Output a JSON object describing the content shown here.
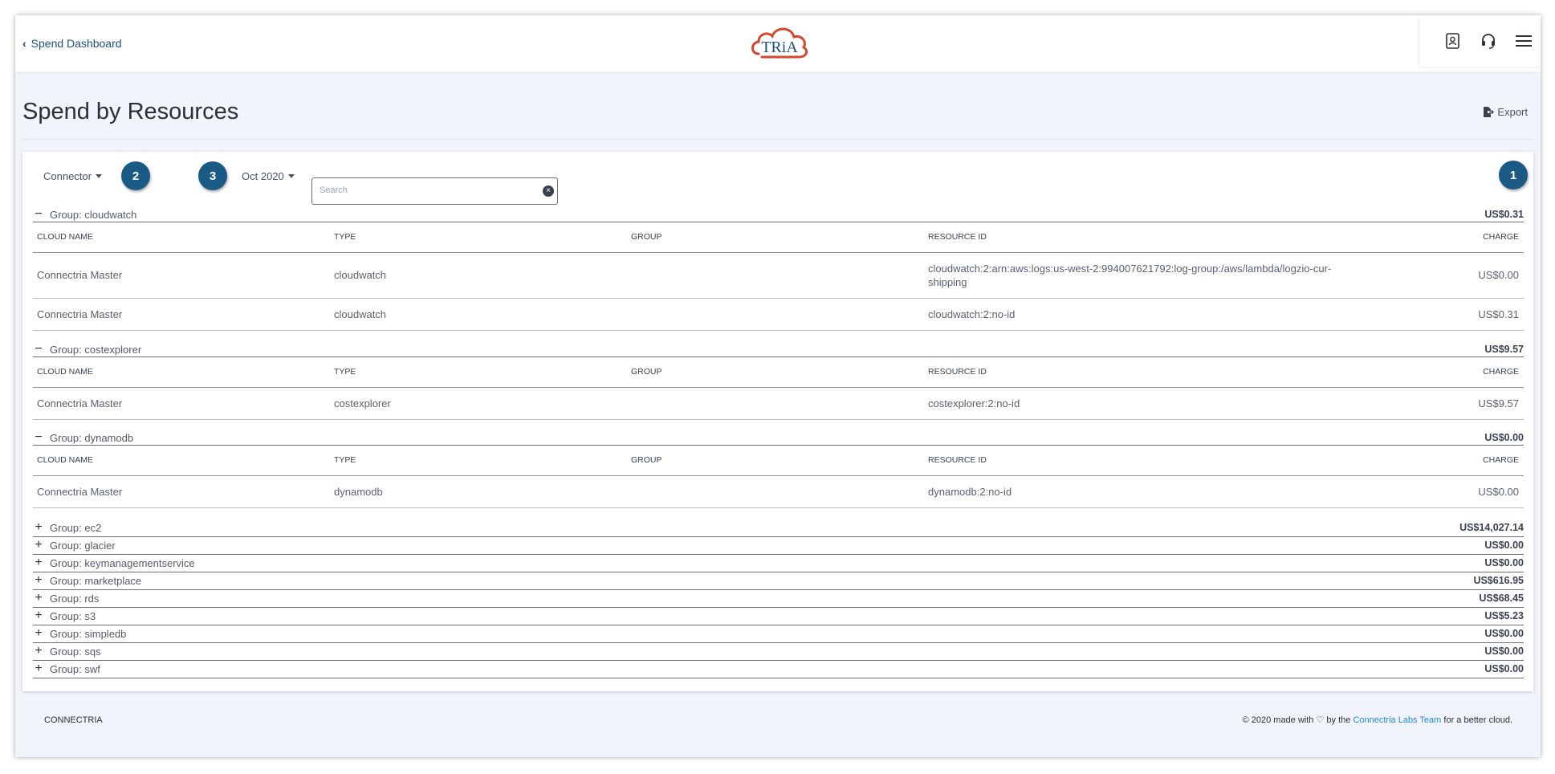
{
  "header": {
    "back_label": "Spend Dashboard",
    "logo_text": "TRiA"
  },
  "page": {
    "title": "Spend by Resources",
    "export_label": "Export"
  },
  "filters": {
    "connector_label": "Connector",
    "date_label": "Oct 2020",
    "search_placeholder": "Search",
    "search_value": "",
    "badges": [
      "1",
      "2",
      "3"
    ]
  },
  "columns": [
    "CLOUD NAME",
    "TYPE",
    "GROUP",
    "RESOURCE ID",
    "CHARGE"
  ],
  "expanded_groups": [
    {
      "name": "Group: cloudwatch",
      "total": "US$0.31",
      "rows": [
        {
          "cloud": "Connectria Master",
          "type": "cloudwatch",
          "group": "",
          "resource_line1": "cloudwatch:2:arn:aws:logs:us-west-2:994007621792:log-group:/aws/lambda/logzio-cur-",
          "resource_line2": "shipping",
          "charge": "US$0.00"
        },
        {
          "cloud": "Connectria Master",
          "type": "cloudwatch",
          "group": "",
          "resource_line1": "cloudwatch:2:no-id",
          "resource_line2": "",
          "charge": "US$0.31"
        }
      ]
    },
    {
      "name": "Group: costexplorer",
      "total": "US$9.57",
      "rows": [
        {
          "cloud": "Connectria Master",
          "type": "costexplorer",
          "group": "",
          "resource_line1": "costexplorer:2:no-id",
          "resource_line2": "",
          "charge": "US$9.57"
        }
      ]
    },
    {
      "name": "Group: dynamodb",
      "total": "US$0.00",
      "rows": [
        {
          "cloud": "Connectria Master",
          "type": "dynamodb",
          "group": "",
          "resource_line1": "dynamodb:2:no-id",
          "resource_line2": "",
          "charge": "US$0.00"
        }
      ]
    }
  ],
  "collapsed_groups": [
    {
      "name": "Group: ec2",
      "total": "US$14,027.14"
    },
    {
      "name": "Group: glacier",
      "total": "US$0.00"
    },
    {
      "name": "Group: keymanagementservice",
      "total": "US$0.00"
    },
    {
      "name": "Group: marketplace",
      "total": "US$616.95"
    },
    {
      "name": "Group: rds",
      "total": "US$68.45"
    },
    {
      "name": "Group: s3",
      "total": "US$5.23"
    },
    {
      "name": "Group: simpledb",
      "total": "US$0.00"
    },
    {
      "name": "Group: sqs",
      "total": "US$0.00"
    },
    {
      "name": "Group: swf",
      "total": "US$0.00"
    }
  ],
  "footer": {
    "brand": "CONNECTRIA",
    "copyright_prefix": "© 2020 made with",
    "copyright_by": "by the",
    "team_link": "Connectria Labs Team",
    "copyright_suffix": "for a better cloud."
  },
  "colors": {
    "accent": "#1c5a86",
    "link": "#2a86c9",
    "background": "#f1f4fa"
  },
  "icons": [
    "chevron-left-icon",
    "contacts-icon",
    "headset-icon",
    "menu-icon",
    "export-icon",
    "clear-icon",
    "collapse-icon",
    "expand-icon",
    "heart-icon"
  ]
}
